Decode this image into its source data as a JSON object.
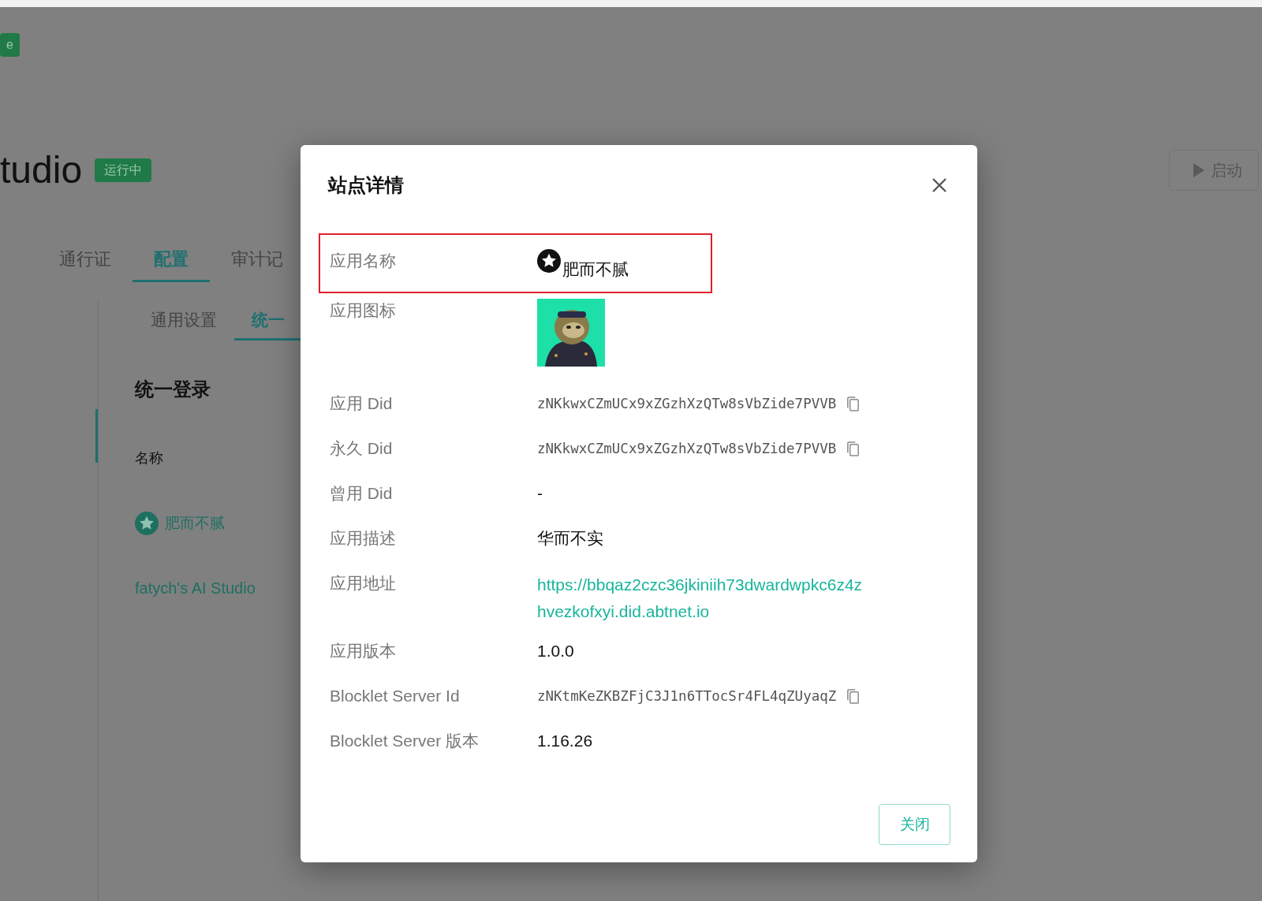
{
  "page": {
    "badge_top": "e",
    "title": "tudio",
    "status": "运行中",
    "start_button": "启动",
    "tabs": [
      {
        "label": "通行证",
        "selected": false
      },
      {
        "label": "配置",
        "selected": true
      },
      {
        "label": "审计记",
        "selected": false
      }
    ],
    "subtabs": [
      {
        "label": "通用设置",
        "selected": false
      },
      {
        "label": "统一",
        "selected": true
      }
    ],
    "section_title": "统一登录",
    "field_label": "名称",
    "app_name": "肥而不腻",
    "app_title": "fatych's AI Studio"
  },
  "dialog": {
    "title": "站点详情",
    "rows": [
      {
        "kind": "name",
        "label": "应用名称",
        "value": "肥而不腻",
        "highlighted": true
      },
      {
        "label": "应用图标",
        "highlighted": false
      },
      {
        "kind": "copy",
        "label": "应用 Did",
        "value": "zNKkwxCZmUCx9xZGzhXzQTw8sVbZide7PVVB",
        "highlighted": false
      },
      {
        "kind": "copy",
        "label": "永久 Did",
        "value": "zNKkwxCZmUCx9xZGzhXzQTw8sVbZide7PVVB",
        "highlighted": false
      },
      {
        "kind": "text",
        "label": "曾用 Did",
        "value": "-",
        "highlighted": false
      },
      {
        "kind": "text",
        "label": "应用描述",
        "value": "华而不实",
        "highlighted": false
      },
      {
        "kind": "link",
        "label": "应用地址",
        "value": "https://bbqaz2czc36jkiniih73dwardwpkc6z4zhvezkofxyi.did.abtnet.io",
        "highlighted": false
      },
      {
        "kind": "text",
        "label": "应用版本",
        "value": "1.0.0",
        "highlighted": false
      },
      {
        "kind": "copy",
        "label": "Blocklet Server Id",
        "value": "zNKtmKeZKBZFjC3J1n6TTocSr4FL4qZUyaqZ",
        "highlighted": false
      },
      {
        "kind": "text",
        "label": "Blocklet Server 版本",
        "value": "1.16.26",
        "highlighted": false
      }
    ],
    "close_button": "关闭"
  }
}
